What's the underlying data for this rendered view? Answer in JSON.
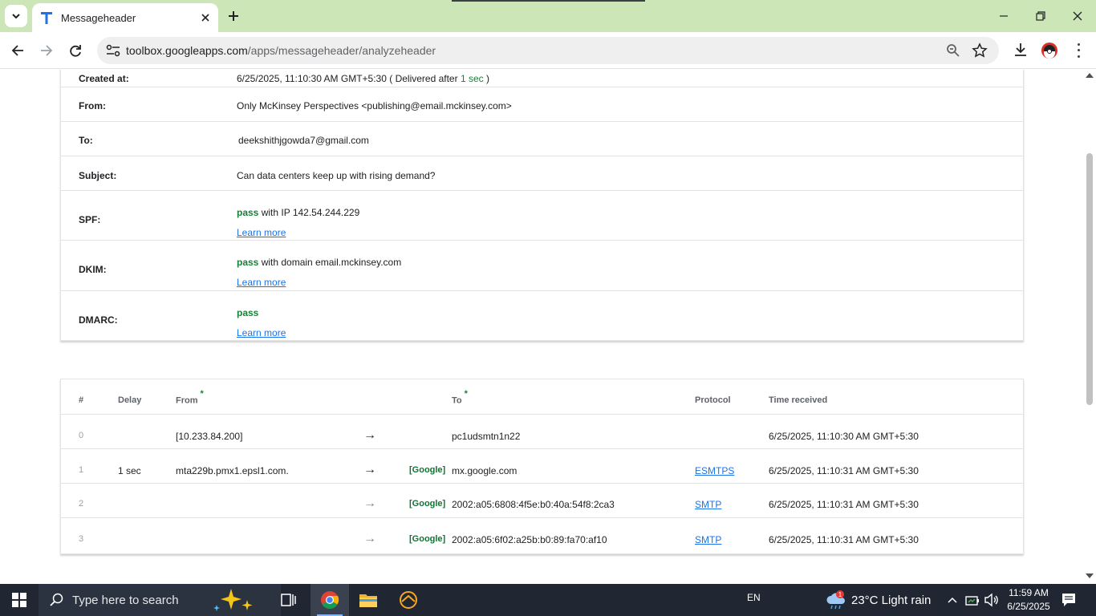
{
  "browser": {
    "tab_title": "Messageheader",
    "url_domain": "toolbox.googleapps.com",
    "url_path": "/apps/messageheader/analyzeheader"
  },
  "summary": {
    "created_label": "Created at:",
    "created_value": "6/25/2025, 11:10:30 AM GMT+5:30 ( Delivered after ",
    "created_delay": "1 sec",
    "created_close": " )",
    "from_label": "From:",
    "from_value": "Only McKinsey Perspectives <publishing@email.mckinsey.com>",
    "to_label": "To:",
    "to_value": "deekshithjgowda7@gmail.com",
    "subject_label": "Subject:",
    "subject_value": "Can data centers keep up with rising demand?",
    "spf_label": "SPF:",
    "spf_status": "pass",
    "spf_detail": " with IP 142.54.244.229",
    "dkim_label": "DKIM:",
    "dkim_status": "pass",
    "dkim_detail": " with domain email.mckinsey.com",
    "dmarc_label": "DMARC:",
    "dmarc_status": "pass",
    "learn_more": "Learn more"
  },
  "hops": {
    "headers": {
      "num": "#",
      "delay": "Delay",
      "from": "From",
      "to": "To",
      "protocol": "Protocol",
      "time": "Time received"
    },
    "star": "*",
    "arrow": "→",
    "rows": [
      {
        "num": "0",
        "delay": "",
        "from": "[10.233.84.200]",
        "badge": "",
        "to": "pc1udsmtn1n22",
        "protocol": "",
        "time": "6/25/2025, 11:10:30 AM GMT+5:30"
      },
      {
        "num": "1",
        "delay": "1 sec",
        "from": "mta229b.pmx1.epsl1.com.",
        "badge": "[Google]",
        "to": "mx.google.com",
        "protocol": "ESMTPS",
        "time": "6/25/2025, 11:10:31 AM GMT+5:30"
      },
      {
        "num": "2",
        "delay": "",
        "from": "",
        "badge": "[Google]",
        "to": "2002:a05:6808:4f5e:b0:40a:54f8:2ca3",
        "protocol": "SMTP",
        "time": "6/25/2025, 11:10:31 AM GMT+5:30"
      },
      {
        "num": "3",
        "delay": "",
        "from": "",
        "badge": "[Google]",
        "to": "2002:a05:6f02:a25b:b0:89:fa70:af10",
        "protocol": "SMTP",
        "time": "6/25/2025, 11:10:31 AM GMT+5:30"
      }
    ]
  },
  "taskbar": {
    "search_placeholder": "Type here to search",
    "lang": "EN",
    "weather": "23°C  Light rain",
    "weather_badge": "1",
    "time": "11:59 AM",
    "date": "6/25/2025"
  }
}
